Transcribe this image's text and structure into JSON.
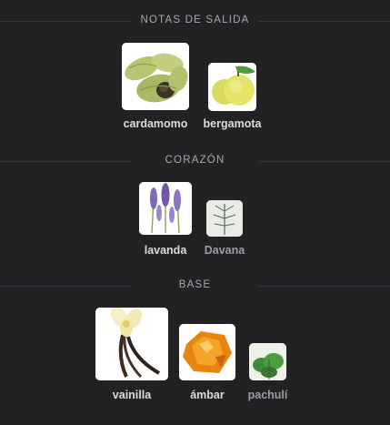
{
  "sections": [
    {
      "title": "NOTAS DE SALIDA",
      "notes": [
        {
          "name": "cardamomo",
          "image": "cardamom-pods-image"
        },
        {
          "name": "bergamota",
          "image": "bergamot-fruit-image"
        }
      ]
    },
    {
      "title": "CORAZÓN",
      "notes": [
        {
          "name": "lavanda",
          "image": "lavender-flowers-image"
        },
        {
          "name": "Davana",
          "image": "davana-herb-image"
        }
      ]
    },
    {
      "title": "BASE",
      "notes": [
        {
          "name": "vainilla",
          "image": "vanilla-pods-flower-image"
        },
        {
          "name": "ámbar",
          "image": "amber-resin-image"
        },
        {
          "name": "pachulí",
          "image": "patchouli-leaves-image"
        }
      ]
    }
  ],
  "colors": {
    "background": "#222225",
    "heading": "#a7a7ad",
    "label_primary": "#dcdcdf",
    "label_secondary": "#9c9ca1"
  }
}
